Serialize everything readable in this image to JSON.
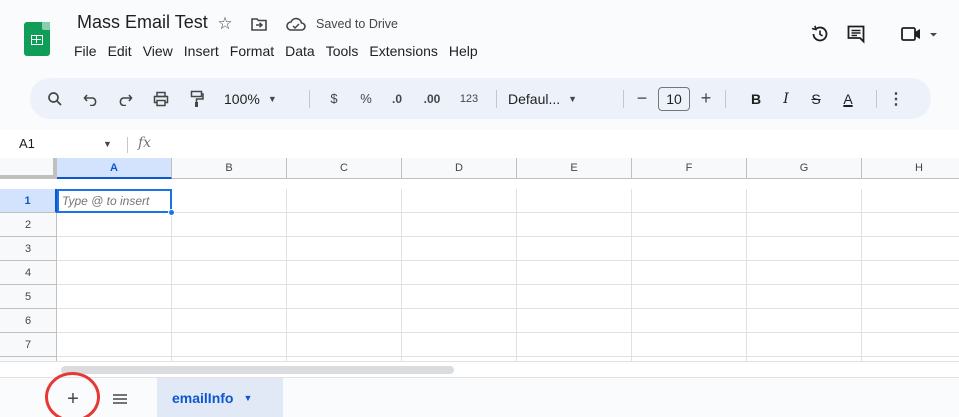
{
  "header": {
    "doc_title": "Mass Email Test",
    "save_status": "Saved to Drive",
    "icons": {
      "star": "star-icon",
      "move": "move-to-folder-icon",
      "cloud": "cloud-saved-icon",
      "history": "version-history-icon",
      "comments": "comments-icon",
      "meet": "meet-video-icon"
    }
  },
  "menu": {
    "items": [
      "File",
      "Edit",
      "View",
      "Insert",
      "Format",
      "Data",
      "Tools",
      "Extensions",
      "Help"
    ]
  },
  "toolbar": {
    "zoom": "100%",
    "currency": "$",
    "percent": "%",
    "decrease_decimal": ".0",
    "increase_decimal": ".00",
    "more_formats": "123",
    "font": "Defaul...",
    "font_size": "10",
    "minus": "−",
    "plus": "+",
    "bold": "B",
    "italic": "I",
    "strikethrough": "S",
    "text_color": "A",
    "more": "⋮"
  },
  "formula_bar": {
    "name_box": "A1",
    "fx": "fx"
  },
  "grid": {
    "columns": [
      "A",
      "B",
      "C",
      "D",
      "E",
      "F",
      "G",
      "H"
    ],
    "rows": [
      "1",
      "2",
      "3",
      "4",
      "5",
      "6",
      "7"
    ],
    "selected_cell_placeholder": "Type @ to insert"
  },
  "sheets": {
    "add_sheet": "+",
    "tabs": [
      {
        "name": "emailInfo"
      }
    ]
  },
  "colors": {
    "accent": "#0b57d0",
    "sheets_green": "#0f9d58",
    "annotation_red": "#e53935"
  }
}
